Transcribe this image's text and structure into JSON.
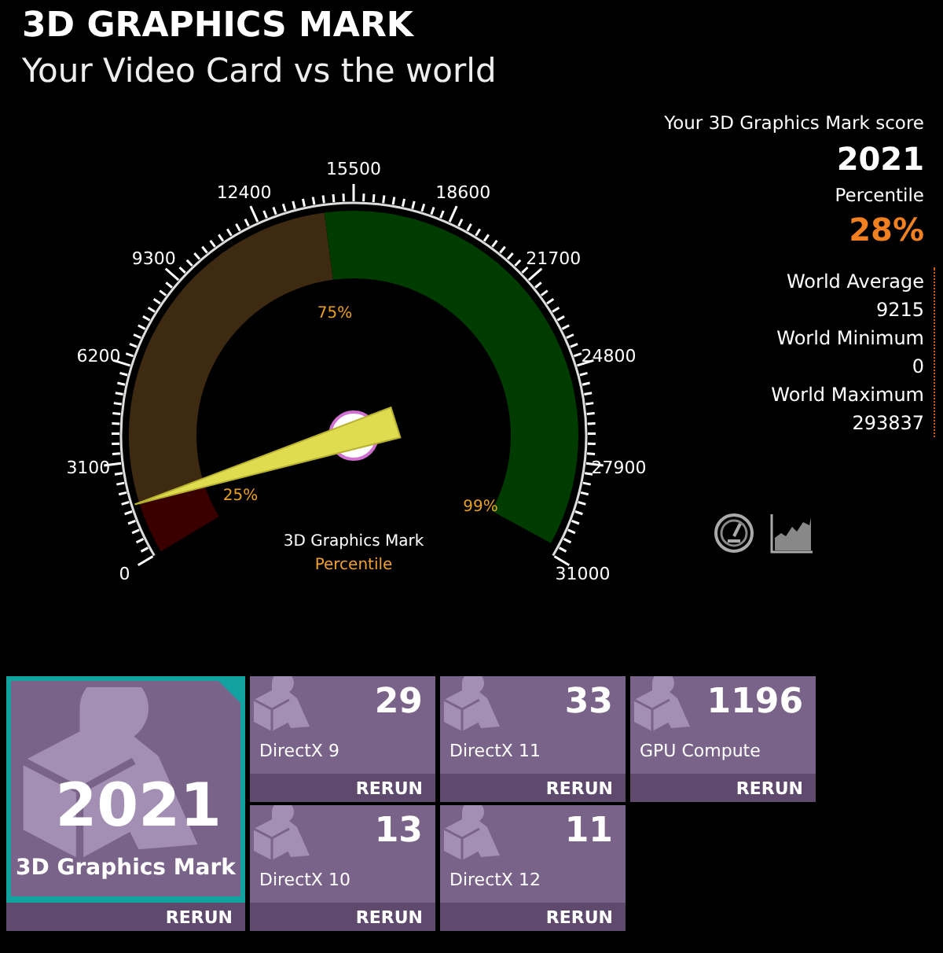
{
  "header": {
    "title": "3D GRAPHICS MARK",
    "subtitle": "Your Video Card vs the world"
  },
  "gauge": {
    "scale_labels": [
      "0",
      "3100",
      "6200",
      "9300",
      "12400",
      "15500",
      "18600",
      "21700",
      "24800",
      "27900",
      "31000"
    ],
    "bands": [
      {
        "label": "25%",
        "color": "#3a0000"
      },
      {
        "label": "75%",
        "color": "#3d2a10"
      },
      {
        "label": "99%",
        "color": "#003b00"
      }
    ],
    "caption": "3D Graphics Mark",
    "sub_caption": "Percentile"
  },
  "score_panel": {
    "heading": "Your 3D Graphics Mark score",
    "score": "2021",
    "percentile_label": "Percentile",
    "percentile": "28%",
    "stats": [
      {
        "label": "World Average",
        "value": "9215"
      },
      {
        "label": "World Minimum",
        "value": "0"
      },
      {
        "label": "World Maximum",
        "value": "293837"
      }
    ]
  },
  "tiles": [
    {
      "kind": "main",
      "value": "2021",
      "label": "3D Graphics Mark",
      "action": "RERUN",
      "selected": true
    },
    {
      "kind": "sub",
      "value": "29",
      "label": "DirectX 9",
      "action": "RERUN",
      "selected": false
    },
    {
      "kind": "sub",
      "value": "33",
      "label": "DirectX 11",
      "action": "RERUN",
      "selected": false
    },
    {
      "kind": "sub",
      "value": "1196",
      "label": "GPU Compute",
      "action": "RERUN",
      "selected": false
    },
    {
      "kind": "sub",
      "value": "13",
      "label": "DirectX 10",
      "action": "RERUN",
      "selected": false
    },
    {
      "kind": "sub",
      "value": "11",
      "label": "DirectX 12",
      "action": "RERUN",
      "selected": false
    }
  ]
}
